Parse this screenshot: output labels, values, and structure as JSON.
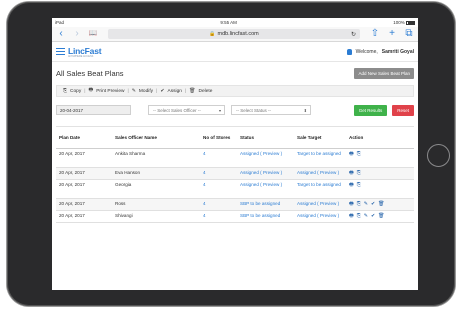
{
  "device": {
    "status": {
      "carrier": "iPad",
      "time": "9:55 AM",
      "battery": "100%"
    }
  },
  "browser": {
    "url": "mdb.lincfast.com",
    "back_glyph": "‹",
    "forward_glyph": "›",
    "bookmarks_glyph": "📖",
    "reload_glyph": "↻",
    "share_glyph": "⇧",
    "add_glyph": "+",
    "tabs_glyph": "⧉"
  },
  "app": {
    "logo": "LincFast",
    "logo_tagline": "ANYWHERE ACCESS",
    "welcome_text": "Welcome,",
    "user_name": "Samriti Goyal"
  },
  "page": {
    "title": "All Sales Beat Plans",
    "add_button": "Add New Sales Beat Plan"
  },
  "toolbar": {
    "copy": "Copy",
    "print_preview": "Print Preview",
    "modify": "Modify",
    "assign": "Assign",
    "delete": "Delete",
    "separator": "|"
  },
  "filters": {
    "date_value": "20-04-2017",
    "officer_placeholder": "-- Select Sales Officer --",
    "status_placeholder": "-- Select Status --",
    "get_results": "Get Results",
    "reset": "Reset"
  },
  "table": {
    "headers": {
      "plan_date": "Plan Date",
      "officer": "Sales Officer Name",
      "stores": "No of Stores",
      "status": "Status",
      "target": "Sale Target",
      "action": "Action"
    },
    "rows": [
      {
        "date": "20 Apr, 2017",
        "officer": "Ankita Sharma",
        "stores": "4",
        "status": "Assigned ( Preview )",
        "target": "Target to be assigned"
      },
      {
        "date": "20 Apr, 2017",
        "officer": "Eva Hanson",
        "stores": "4",
        "status": "Assigned ( Preview )",
        "target": "Assigned ( Preview )"
      },
      {
        "date": "20 Apr, 2017",
        "officer": "Georgia",
        "stores": "4",
        "status": "Assigned ( Preview )",
        "target": "Target to be assigned"
      },
      {
        "date": "20 Apr, 2017",
        "officer": "Ross",
        "stores": "4",
        "status": "SBP to be assigned",
        "target": "Assigned ( Preview )"
      },
      {
        "date": "20 Apr, 2017",
        "officer": "Shivangi",
        "stores": "4",
        "status": "SBP to be assigned",
        "target": "Assigned ( Preview )"
      }
    ]
  },
  "icons": {
    "print": "🖶",
    "copy": "⎘",
    "modify": "✎",
    "assign": "✔",
    "delete": "🗑"
  }
}
